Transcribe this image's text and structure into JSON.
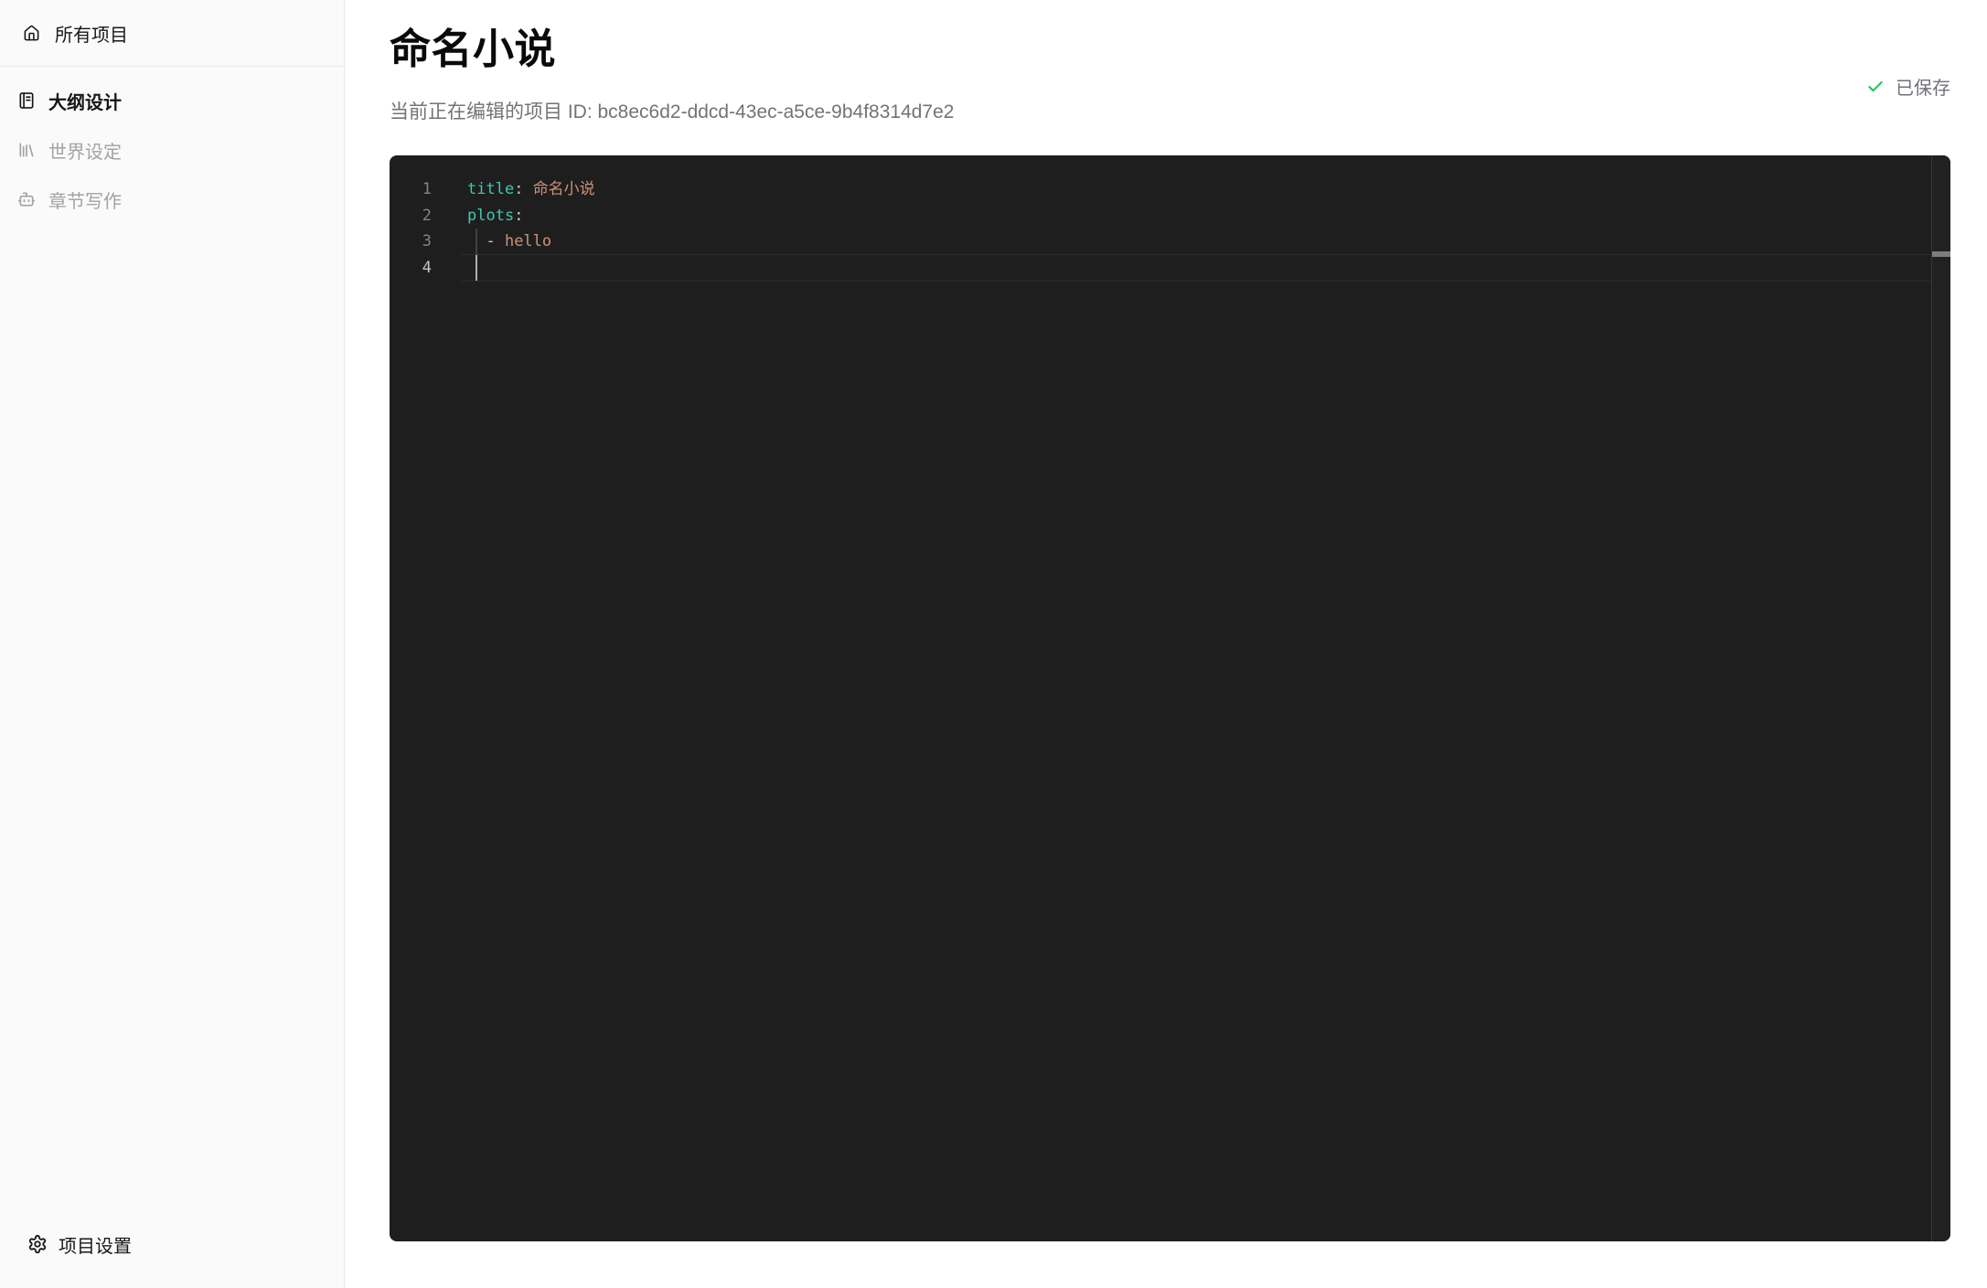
{
  "sidebar": {
    "header": {
      "id": "all-projects",
      "icon": "home-icon",
      "label": "所有项目"
    },
    "nav": [
      {
        "id": "outline-design",
        "icon": "notebook-text-icon",
        "label": "大纲设计",
        "active": true
      },
      {
        "id": "world-setting",
        "icon": "library-icon",
        "label": "世界设定",
        "active": false
      },
      {
        "id": "chapter-writing",
        "icon": "bot-icon",
        "label": "章节写作",
        "active": false
      }
    ],
    "footer": {
      "id": "project-settings",
      "icon": "settings-icon",
      "label": "项目设置"
    }
  },
  "header": {
    "title": "命名小说",
    "subtitle": "当前正在编辑的项目 ID: bc8ec6d2-ddcd-43ec-a5ce-9b4f8314d7e2",
    "save_status": {
      "icon": "check-icon",
      "label": "已保存"
    }
  },
  "editor": {
    "language": "yaml",
    "lines": [
      {
        "number": "1",
        "active": false,
        "tokens": [
          {
            "text": "title",
            "type": "key"
          },
          {
            "text": ":",
            "type": "punct"
          },
          {
            "text": " ",
            "type": "plain"
          },
          {
            "text": "命名小说",
            "type": "string"
          }
        ]
      },
      {
        "number": "2",
        "active": false,
        "tokens": [
          {
            "text": "plots",
            "type": "key"
          },
          {
            "text": ":",
            "type": "punct"
          }
        ]
      },
      {
        "number": "3",
        "active": false,
        "tokens": [
          {
            "text": "  - ",
            "type": "punct"
          },
          {
            "text": "hello",
            "type": "string"
          }
        ]
      },
      {
        "number": "4",
        "active": true,
        "tokens": []
      }
    ]
  },
  "colors": {
    "saved_check_green": "#22c55e",
    "status_text": "#71717a",
    "editor_background": "#1e1e1e",
    "token_key": "#3dc9b0",
    "token_string": "#ce9178",
    "token_punct": "#cccccc",
    "line_number": "#858585",
    "line_number_active": "#c6c6c6",
    "cursor": "#aeafad",
    "sidebar_active_text": "#171717",
    "sidebar_inactive_text": "#a3a3a3"
  }
}
